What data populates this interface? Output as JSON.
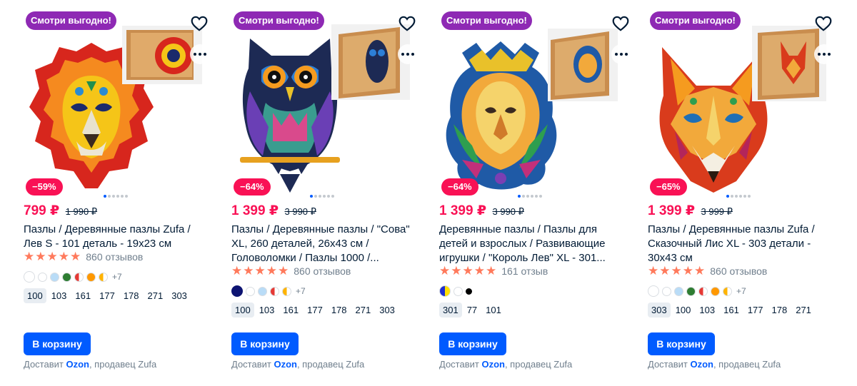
{
  "colors": {
    "accent": "#005bff",
    "price": "#f91155",
    "promo": "#8e29b4",
    "star": "#ff7a5c"
  },
  "cards": [
    {
      "promo_badge": "Смотри выгодно!",
      "discount": "−59%",
      "price": "799 ₽",
      "old_price": "1 990 ₽",
      "title": "Пазлы / Деревянные пазлы Zufa / Лев S - 101 деталь - 19x23 см",
      "rating_stars": 5,
      "reviews": "860 отзывов",
      "swatches": [
        "#ffffff",
        "#ffffff",
        "#b9dcf7",
        "#2e7d32",
        "#e53935",
        "#ff9800",
        "#ffb300"
      ],
      "swatches_more": "+7",
      "sizes": [
        "100",
        "103",
        "161",
        "177",
        "178",
        "271",
        "303"
      ],
      "selected_size": "100",
      "cart_label": "В корзину",
      "delivery_prefix": "Доставит ",
      "delivery_brand": "Ozon",
      "delivery_suffix": ", продавец Zufa"
    },
    {
      "promo_badge": "Смотри выгодно!",
      "discount": "−64%",
      "price": "1 399 ₽",
      "old_price": "3 990 ₽",
      "title": "Пазлы / Деревянные пазлы / \"Сова\" XL, 260 деталей, 26x43 см / Головоломки / Пазлы 1000 /...",
      "rating_stars": 5,
      "reviews": "860 отзывов",
      "swatches": [
        "#0d1472",
        "#ffffff",
        "#b9dcf7",
        "#e53935",
        "#ffb300"
      ],
      "swatches_more": "+7",
      "sizes": [
        "100",
        "103",
        "161",
        "177",
        "178",
        "271",
        "303"
      ],
      "selected_size": "100",
      "cart_label": "В корзину",
      "delivery_prefix": "Доставит ",
      "delivery_brand": "Ozon",
      "delivery_suffix": ", продавец Zufa"
    },
    {
      "promo_badge": "Смотри выгодно!",
      "discount": "−64%",
      "price": "1 399 ₽",
      "old_price": "3 990 ₽",
      "title": "Деревянные пазлы / Пазлы для детей и взрослых / Развивающие игрушки / \"Король Лев\" XL - 301...",
      "rating_stars": 5,
      "reviews": "161 отзыв",
      "swatches": [
        "#1f2fd1",
        "#ffffff",
        "#000000"
      ],
      "swatches_more": "",
      "sizes": [
        "301",
        "77",
        "101"
      ],
      "selected_size": "301",
      "cart_label": "В корзину",
      "delivery_prefix": "Доставит ",
      "delivery_brand": "Ozon",
      "delivery_suffix": ", продавец Zufa"
    },
    {
      "promo_badge": "Смотри выгодно!",
      "discount": "−65%",
      "price": "1 399 ₽",
      "old_price": "3 999 ₽",
      "title": "Пазлы / Деревянные пазлы Zufa / Сказочный Лис XL - 303 детали - 30x43 см",
      "rating_stars": 5,
      "reviews": "860 отзывов",
      "swatches": [
        "#ffffff",
        "#ffffff",
        "#b9dcf7",
        "#2e7d32",
        "#e53935",
        "#ff9800",
        "#ffb300"
      ],
      "swatches_more": "+7",
      "sizes": [
        "303",
        "100",
        "103",
        "161",
        "177",
        "178",
        "271"
      ],
      "selected_size": "303",
      "cart_label": "В корзину",
      "delivery_prefix": "Доставит ",
      "delivery_brand": "Ozon",
      "delivery_suffix": ", продавец Zufa"
    }
  ]
}
